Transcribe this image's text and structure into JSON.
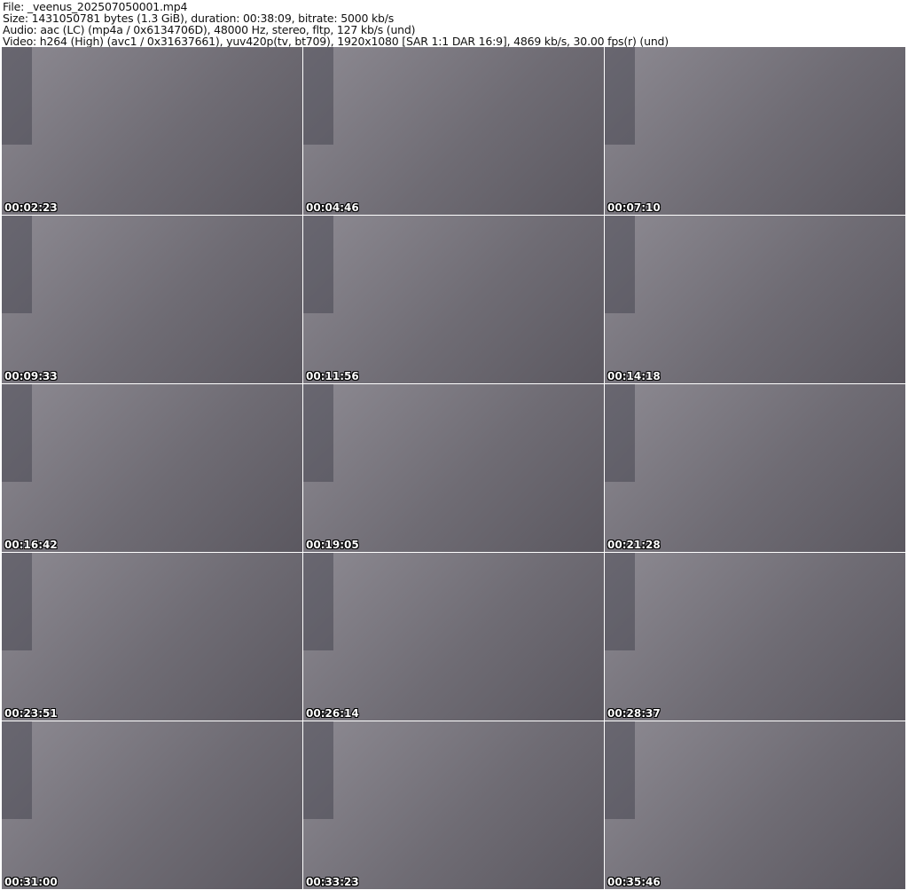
{
  "header": {
    "file": "File: _veenus_202507050001.mp4",
    "size": "Size: 1431050781 bytes (1.3 GiB), duration: 00:38:09, bitrate: 5000 kb/s",
    "audio": "Audio: aac (LC) (mp4a / 0x6134706D), 48000 Hz, stereo, fltp, 127 kb/s (und)",
    "video": "Video: h264 (High) (avc1 / 0x31637661), yuv420p(tv, bt709), 1920x1080 [SAR 1:1 DAR 16:9], 4869 kb/s, 30.00 fps(r) (und)"
  },
  "thumbnails": [
    {
      "timestamp": "00:02:23"
    },
    {
      "timestamp": "00:04:46"
    },
    {
      "timestamp": "00:07:10"
    },
    {
      "timestamp": "00:09:33"
    },
    {
      "timestamp": "00:11:56"
    },
    {
      "timestamp": "00:14:18"
    },
    {
      "timestamp": "00:16:42"
    },
    {
      "timestamp": "00:19:05"
    },
    {
      "timestamp": "00:21:28"
    },
    {
      "timestamp": "00:23:51"
    },
    {
      "timestamp": "00:26:14"
    },
    {
      "timestamp": "00:28:37"
    },
    {
      "timestamp": "00:31:00"
    },
    {
      "timestamp": "00:33:23"
    },
    {
      "timestamp": "00:35:46"
    }
  ]
}
